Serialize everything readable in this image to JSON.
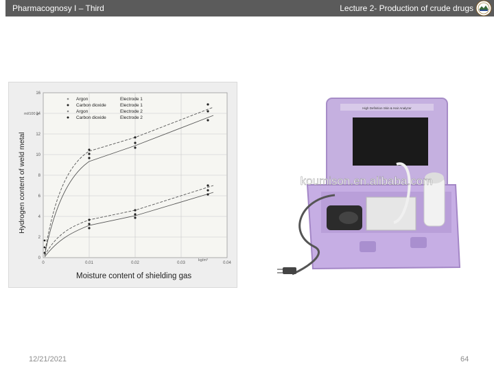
{
  "header": {
    "left_text": "Pharmacognosy I – Third",
    "right_text": "Lecture 2- Production of crude drugs",
    "logo_icon": "university-seal-icon"
  },
  "chart_image": {
    "ylabel": "Hydrogen content of weld metal",
    "xlabel": "Moisture content of shielding gas",
    "y_unit": "ml/100 g",
    "x_unit": "kg/m³",
    "y_ticks": [
      "16",
      "14",
      "12",
      "10",
      "8",
      "6",
      "4",
      "2",
      "0"
    ],
    "x_ticks": [
      "0",
      "0.01",
      "0.02",
      "0.03",
      "0.04"
    ],
    "legend": [
      {
        "gas": "Argon",
        "electrode": "Electrode 1"
      },
      {
        "gas": "Carbon dioxide",
        "electrode": "Electrode 1"
      },
      {
        "gas": "Argon",
        "electrode": "Electrode 2"
      },
      {
        "gas": "Carbon dioxide",
        "electrode": "Electrode 2"
      }
    ]
  },
  "device_image": {
    "screen_caption": "High Definition Skin & Hair Analyzer",
    "watermark": "koumison.en.alibaba.com"
  },
  "footer": {
    "date": "12/21/2021",
    "page_number": "64"
  }
}
